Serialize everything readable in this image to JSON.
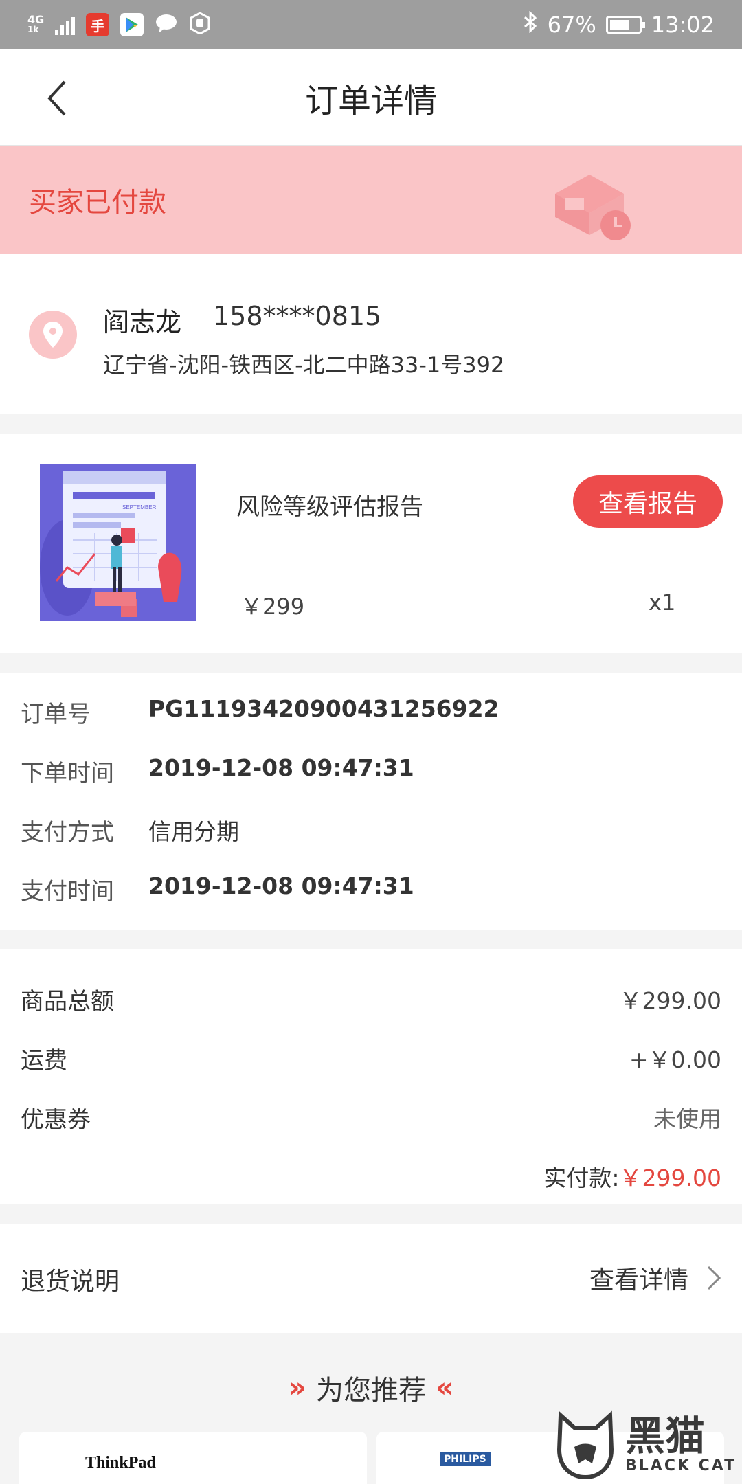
{
  "status_bar": {
    "network": "4G",
    "signal_sub": "1k",
    "battery_percent": "67%",
    "battery_level": 0.67,
    "time": "13:02",
    "bluetooth_icon": "bluetooth-icon"
  },
  "header": {
    "title": "订单详情",
    "back_icon": "chevron-left-icon"
  },
  "order_status": {
    "text": "买家已付款",
    "icon": "package-clock-icon",
    "color": "#e4473f",
    "background": "#fac5c7"
  },
  "address": {
    "icon": "location-pin-icon",
    "name": "阎志龙",
    "phone": "158****0815",
    "detail": "辽宁省-沈阳-铁西区-北二中路33-1号392"
  },
  "product": {
    "name": "风险等级评估报告",
    "price": "￥299",
    "quantity": "x1",
    "button_label": "查看报告",
    "button_color": "#ed4b4b",
    "thumbnail_text": "SEPTEMBER"
  },
  "order_info": {
    "rows": [
      {
        "label": "订单号",
        "value": "PG11193420900431256922"
      },
      {
        "label": "下单时间",
        "value": "2019-12-08 09:47:31"
      },
      {
        "label": "支付方式",
        "value": "信用分期"
      },
      {
        "label": "支付时间",
        "value": "2019-12-08 09:47:31"
      }
    ]
  },
  "amounts": {
    "rows": [
      {
        "label": "商品总额",
        "value": "￥299.00"
      },
      {
        "label": "运费",
        "value": "+￥0.00"
      },
      {
        "label": "优惠券",
        "value": "未使用"
      }
    ],
    "paid_label": "实付款:",
    "paid_value": "￥299.00"
  },
  "returns": {
    "label": "退货说明",
    "link": "查看详情"
  },
  "recommend": {
    "title": "为您推荐",
    "left_arrows": "»",
    "right_arrows": "«",
    "brands": [
      "ThinkPad",
      "PHILIPS"
    ]
  },
  "watermark": {
    "cn": "黑猫",
    "en": "BLACK CAT"
  }
}
